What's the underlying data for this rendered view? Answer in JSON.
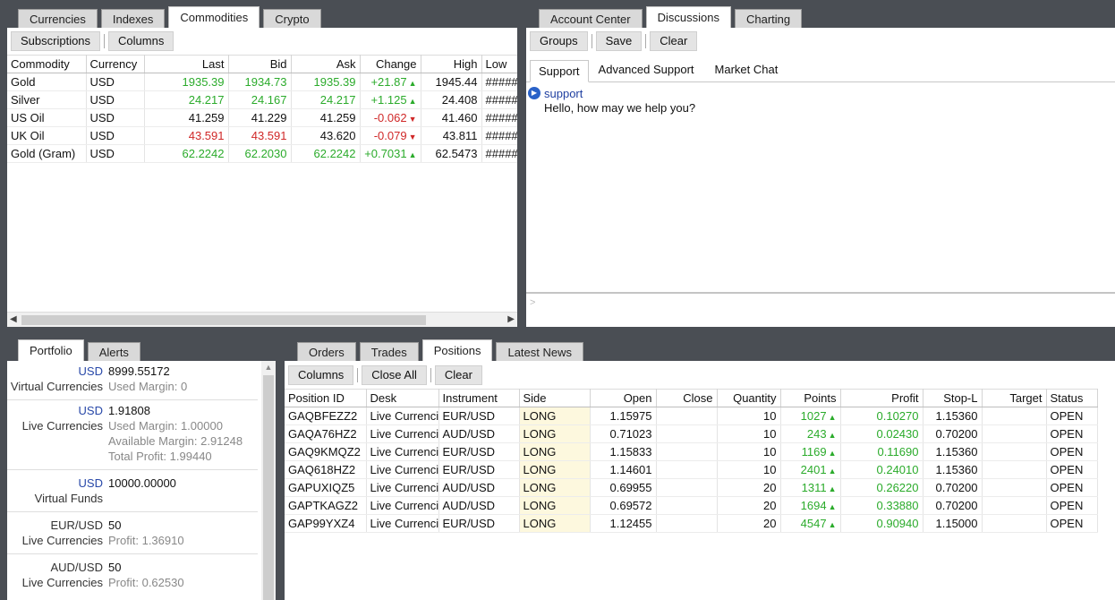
{
  "market_tabs": [
    "Currencies",
    "Indexes",
    "Commodities",
    "Crypto"
  ],
  "market_toolbar": {
    "subscriptions": "Subscriptions",
    "columns": "Columns"
  },
  "commodities": {
    "headers": [
      "Commodity",
      "Currency",
      "Last",
      "Bid",
      "Ask",
      "Change",
      "High",
      "Low"
    ],
    "rows": [
      {
        "name": "Gold",
        "currency": "USD",
        "last": "1935.39",
        "bid": "1934.73",
        "ask": "1935.39",
        "change": "+21.87",
        "high": "1945.44",
        "low": "#####"
      },
      {
        "name": "Silver",
        "currency": "USD",
        "last": "24.217",
        "bid": "24.167",
        "ask": "24.217",
        "change": "+1.125",
        "high": "24.408",
        "low": "#####"
      },
      {
        "name": "US Oil",
        "currency": "USD",
        "last": "41.259",
        "bid": "41.229",
        "ask": "41.259",
        "change": "-0.062",
        "high": "41.460",
        "low": "#####"
      },
      {
        "name": "UK Oil",
        "currency": "USD",
        "last": "43.591",
        "bid": "43.591",
        "ask": "43.620",
        "change": "-0.079",
        "high": "43.811",
        "low": "#####"
      },
      {
        "name": "Gold (Gram)",
        "currency": "USD",
        "last": "62.2242",
        "bid": "62.2030",
        "ask": "62.2242",
        "change": "+0.7031",
        "high": "62.5473",
        "low": "#####"
      }
    ]
  },
  "discussion_tabs": [
    "Account Center",
    "Discussions",
    "Charting"
  ],
  "discussion_toolbar": {
    "groups": "Groups",
    "save": "Save",
    "clear": "Clear"
  },
  "discussion_subtabs": [
    "Support",
    "Advanced Support",
    "Market Chat"
  ],
  "chat": {
    "sender": "support",
    "message": "Hello, how may we help you?",
    "prompt": ">"
  },
  "portfolio_tabs": [
    "Portfolio",
    "Alerts"
  ],
  "portfolio": {
    "b1": {
      "cur": "USD",
      "amount": "8999.55172",
      "label": "Virtual Currencies",
      "margin_label": "Used Margin:",
      "margin": "0"
    },
    "b2": {
      "cur": "USD",
      "amount": "1.91808",
      "label": "Live Currencies",
      "used_label": "Used Margin:",
      "used": "1.00000",
      "avail_label": "Available Margin:",
      "avail": "2.91248",
      "profit_label": "Total Profit:",
      "profit": "1.99440"
    },
    "b3": {
      "cur": "USD",
      "amount": "10000.00000",
      "label": "Virtual Funds"
    },
    "b4": {
      "pair": "EUR/USD",
      "amount": "50",
      "label": "Live Currencies",
      "profit_label": "Profit:",
      "profit": "1.36910"
    },
    "b5": {
      "pair": "AUD/USD",
      "amount": "50",
      "label": "Live Currencies",
      "profit_label": "Profit:",
      "profit": "0.62530"
    }
  },
  "trade_tabs": [
    "Orders",
    "Trades",
    "Positions",
    "Latest News"
  ],
  "positions_toolbar": {
    "columns": "Columns",
    "close_all": "Close All",
    "clear": "Clear"
  },
  "positions": {
    "headers": [
      "Position ID",
      "Desk",
      "Instrument",
      "Side",
      "Open",
      "Close",
      "Quantity",
      "Points",
      "Profit",
      "Stop-L",
      "Target",
      "Status"
    ],
    "rows": [
      {
        "id": "GAQBFEZZ2",
        "desk": "Live Currencies",
        "instrument": "EUR/USD",
        "side": "LONG",
        "open": "1.15975",
        "close": "",
        "qty": "10",
        "points": "1027",
        "profit": "0.10270",
        "stop": "1.15360",
        "target": "",
        "status": "OPEN"
      },
      {
        "id": "GAQA76HZ2",
        "desk": "Live Currencies",
        "instrument": "AUD/USD",
        "side": "LONG",
        "open": "0.71023",
        "close": "",
        "qty": "10",
        "points": "243",
        "profit": "0.02430",
        "stop": "0.70200",
        "target": "",
        "status": "OPEN"
      },
      {
        "id": "GAQ9KMQZ2",
        "desk": "Live Currencies",
        "instrument": "EUR/USD",
        "side": "LONG",
        "open": "1.15833",
        "close": "",
        "qty": "10",
        "points": "1169",
        "profit": "0.11690",
        "stop": "1.15360",
        "target": "",
        "status": "OPEN"
      },
      {
        "id": "GAQ618HZ2",
        "desk": "Live Currencies",
        "instrument": "EUR/USD",
        "side": "LONG",
        "open": "1.14601",
        "close": "",
        "qty": "10",
        "points": "2401",
        "profit": "0.24010",
        "stop": "1.15360",
        "target": "",
        "status": "OPEN"
      },
      {
        "id": "GAPUXIQZ5",
        "desk": "Live Currencies",
        "instrument": "AUD/USD",
        "side": "LONG",
        "open": "0.69955",
        "close": "",
        "qty": "20",
        "points": "1311",
        "profit": "0.26220",
        "stop": "0.70200",
        "target": "",
        "status": "OPEN"
      },
      {
        "id": "GAPTKAGZ2",
        "desk": "Live Currencies",
        "instrument": "AUD/USD",
        "side": "LONG",
        "open": "0.69572",
        "close": "",
        "qty": "20",
        "points": "1694",
        "profit": "0.33880",
        "stop": "0.70200",
        "target": "",
        "status": "OPEN"
      },
      {
        "id": "GAP99YXZ4",
        "desk": "Live Currencies",
        "instrument": "EUR/USD",
        "side": "LONG",
        "open": "1.12455",
        "close": "",
        "qty": "20",
        "points": "4547",
        "profit": "0.90940",
        "stop": "1.15000",
        "target": "",
        "status": "OPEN"
      }
    ]
  },
  "colors": {
    "up": "#2bab2b",
    "down": "#d02828",
    "side_bg": "#fdf8de",
    "chrome": "#4a4e54"
  }
}
